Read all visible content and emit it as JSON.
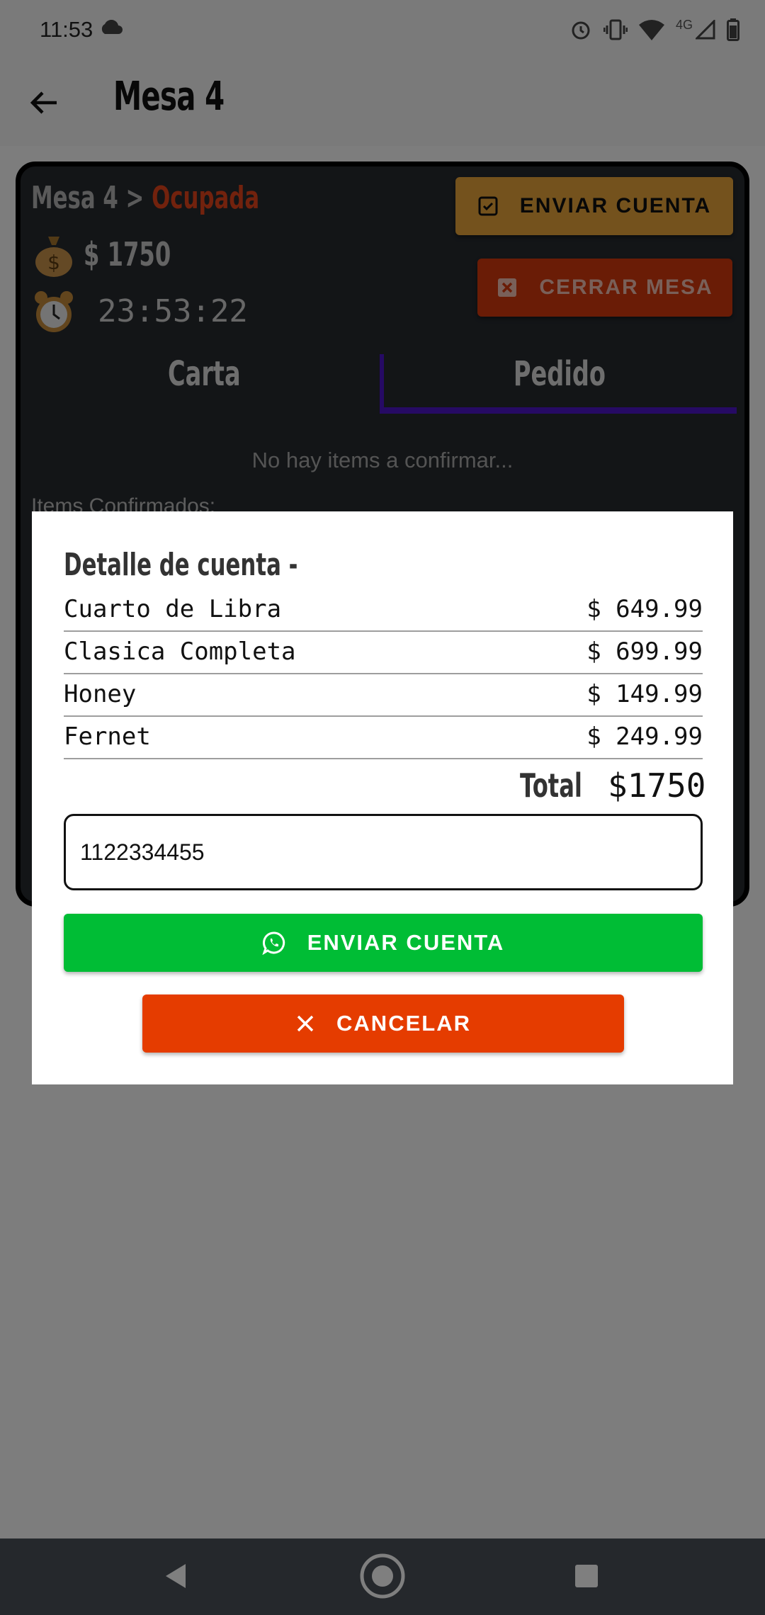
{
  "status_bar": {
    "time": "11:53",
    "network_label": "4G"
  },
  "app_bar": {
    "title": "Mesa 4",
    "back_icon": "arrow-left-icon"
  },
  "table_card": {
    "mesa_label": "Mesa 4 >",
    "status": "Ocupada",
    "total": "$ 1750",
    "timer": "23:53:22",
    "btn_enviar_cuenta": "ENVIAR CUENTA",
    "btn_cerrar_mesa": "CERRAR MESA",
    "tabs": [
      {
        "label": "Carta",
        "selected": false
      },
      {
        "label": "Pedido",
        "selected": true
      }
    ],
    "no_items_text": "No hay items a confirmar...",
    "items_confirmados_label": "Items Confirmados:"
  },
  "dialog": {
    "title": "Detalle de cuenta -",
    "items": [
      {
        "name": "Cuarto de Libra",
        "price": "$ 649.99"
      },
      {
        "name": "Clasica Completa",
        "price": "$ 699.99"
      },
      {
        "name": "Honey",
        "price": "$ 149.99"
      },
      {
        "name": "Fernet",
        "price": "$ 249.99"
      }
    ],
    "total_label": "Total",
    "total_value": "$1750",
    "phone_value": "1122334455",
    "btn_enviar": "ENVIAR CUENTA",
    "btn_cancelar": "CANCELAR"
  },
  "colors": {
    "accent_orange": "#e9a43a",
    "danger": "#d5390d",
    "whatsapp_green": "#00bd35",
    "cancel_red": "#e53c00",
    "tab_indicator": "#4d14c9"
  }
}
